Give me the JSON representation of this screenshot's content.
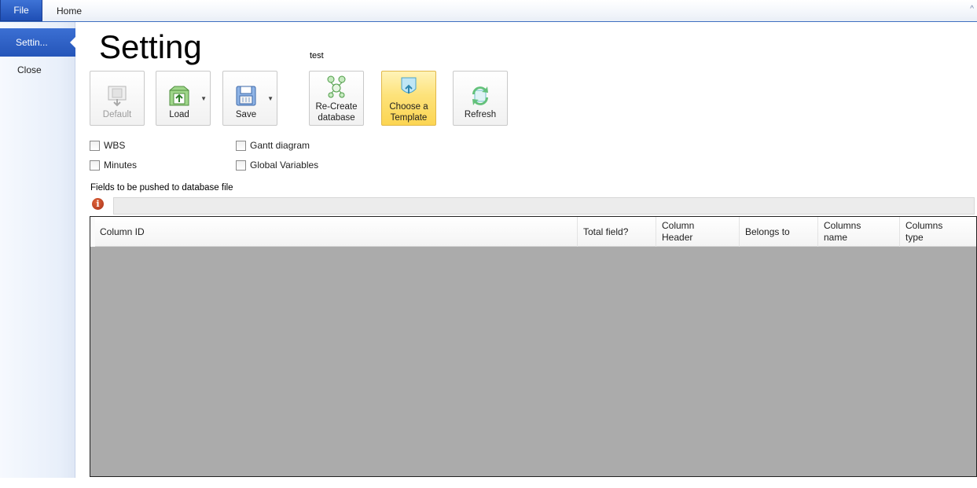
{
  "tabs": {
    "file": "File",
    "home": "Home",
    "collapse_glyph": "^"
  },
  "sidebar": {
    "active": "Settin...",
    "items": [
      "Close"
    ]
  },
  "page": {
    "title": "Setting",
    "group_label": "test"
  },
  "toolbar": {
    "default": {
      "label": "Default",
      "enabled": false
    },
    "load": {
      "label": "Load",
      "has_dropdown": true
    },
    "save": {
      "label": "Save",
      "has_dropdown": true
    },
    "recreate": {
      "line1": "Re-Create",
      "line2": "database"
    },
    "template": {
      "line1": "Choose a",
      "line2": "Template",
      "highlighted": true
    },
    "refresh": {
      "label": "Refresh"
    }
  },
  "checkboxes": {
    "wbs": {
      "label": "WBS",
      "checked": false
    },
    "minutes": {
      "label": "Minutes",
      "checked": false
    },
    "gantt": {
      "label": "Gantt diagram",
      "checked": false
    },
    "globals": {
      "label": "Global Variables",
      "checked": false
    }
  },
  "fields": {
    "label": "Fields to be pushed to database file",
    "info_icon_glyph": "i",
    "message": ""
  },
  "grid": {
    "columns": {
      "column_id": "Column ID",
      "total_field": "Total field?",
      "column_header_1": "Column",
      "column_header_2": "Header",
      "belongs_to": "Belongs to",
      "columns_name_1": "Columns",
      "columns_name_2": "name",
      "columns_type_1": "Columns",
      "columns_type_2": "type"
    }
  },
  "colors": {
    "accent": "#2555b9",
    "highlight": "#fcd552",
    "grid_empty": "#ababab"
  }
}
